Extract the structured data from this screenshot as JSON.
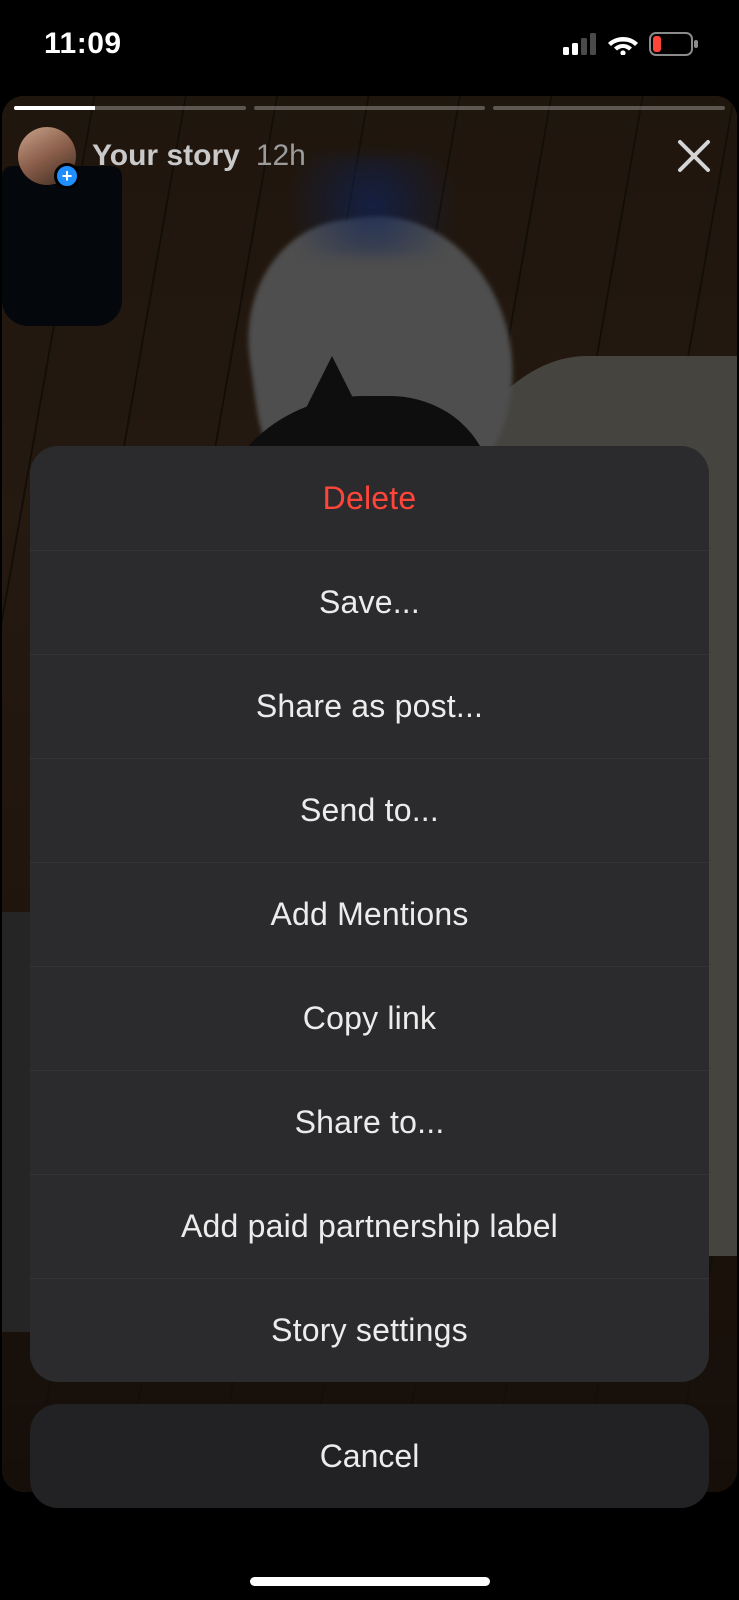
{
  "status_bar": {
    "time": "11:09",
    "cellular_bars": 2,
    "battery_low": true
  },
  "story": {
    "title": "Your story",
    "age": "12h",
    "segments": 3,
    "segment_progress": [
      0.35,
      0,
      0
    ]
  },
  "action_sheet": {
    "options": [
      {
        "id": "delete",
        "label": "Delete",
        "destructive": true
      },
      {
        "id": "save",
        "label": "Save...",
        "destructive": false
      },
      {
        "id": "share-as-post",
        "label": "Share as post...",
        "destructive": false
      },
      {
        "id": "send-to",
        "label": "Send to...",
        "destructive": false
      },
      {
        "id": "add-mentions",
        "label": "Add Mentions",
        "destructive": false
      },
      {
        "id": "copy-link",
        "label": "Copy link",
        "destructive": false
      },
      {
        "id": "share-to",
        "label": "Share to...",
        "destructive": false
      },
      {
        "id": "add-paid-partnership",
        "label": "Add paid partnership label",
        "destructive": false
      },
      {
        "id": "story-settings",
        "label": "Story settings",
        "destructive": false
      }
    ],
    "cancel_label": "Cancel"
  },
  "colors": {
    "destructive": "#ff453a",
    "sheet_bg": "#2b2b2d",
    "cancel_bg": "#222224"
  }
}
